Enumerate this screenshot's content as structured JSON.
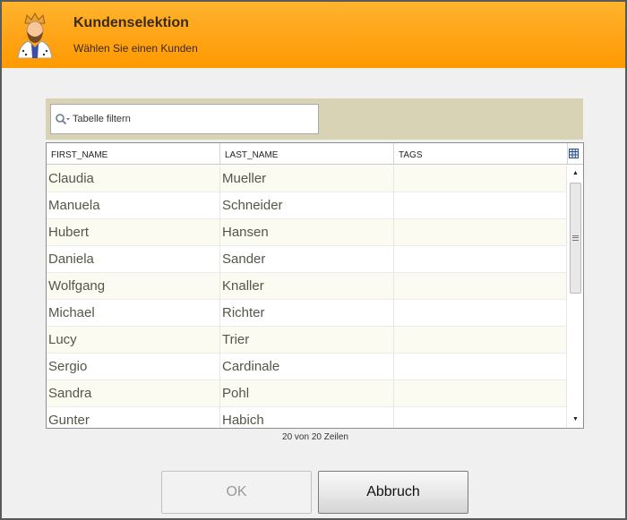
{
  "header": {
    "title": "Kundenselektion",
    "subtitle": "Wählen Sie einen Kunden",
    "avatar_icon": "customer-avatar-icon"
  },
  "filter": {
    "placeholder": "Tabelle filtern",
    "value": ""
  },
  "table": {
    "columns": [
      "FIRST_NAME",
      "LAST_NAME",
      "TAGS"
    ],
    "rows": [
      [
        "Claudia",
        "Mueller",
        ""
      ],
      [
        "Manuela",
        "Schneider",
        ""
      ],
      [
        "Hubert",
        "Hansen",
        ""
      ],
      [
        "Daniela",
        "Sander",
        ""
      ],
      [
        "Wolfgang",
        "Knaller",
        ""
      ],
      [
        "Michael",
        "Richter",
        ""
      ],
      [
        "Lucy",
        "Trier",
        ""
      ],
      [
        "Sergio",
        "Cardinale",
        ""
      ],
      [
        "Sandra",
        "Pohl",
        ""
      ],
      [
        "Gunter",
        "Habich",
        ""
      ]
    ],
    "row_count_text": "20 von 20 Zeilen"
  },
  "buttons": {
    "ok_label": "OK",
    "cancel_label": "Abbruch"
  },
  "colors": {
    "header_orange": "#ff9a00",
    "filterbar_bg": "#d8d3b4",
    "row_alt": "#fbfbf2"
  }
}
